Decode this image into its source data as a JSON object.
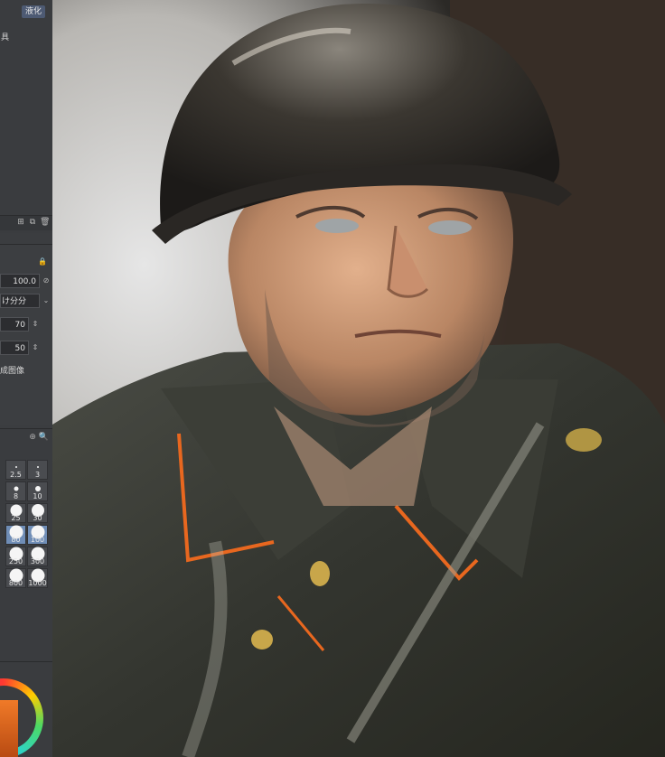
{
  "sidebar": {
    "tab_label": "液化",
    "tool_label": "具",
    "props": {
      "opacity_value": "100.0",
      "mode_value": "け分分",
      "value_a": "70",
      "value_b": "50",
      "option_label": "成图像"
    },
    "brush_sizes": [
      {
        "label": "2.5",
        "dot": 2,
        "selected": false
      },
      {
        "label": "3",
        "dot": 2,
        "selected": false
      },
      {
        "label": "8",
        "dot": 5,
        "selected": false
      },
      {
        "label": "10",
        "dot": 6,
        "selected": false
      },
      {
        "label": "25",
        "dot": 13,
        "selected": false
      },
      {
        "label": "30",
        "dot": 14,
        "selected": false
      },
      {
        "label": "80",
        "dot": 15,
        "selected": true
      },
      {
        "label": "100",
        "dot": 15,
        "selected": true
      },
      {
        "label": "250",
        "dot": 15,
        "selected": false
      },
      {
        "label": "300",
        "dot": 15,
        "selected": false
      },
      {
        "label": "800",
        "dot": 15,
        "selected": false
      },
      {
        "label": "1000",
        "dot": 15,
        "selected": false
      }
    ]
  },
  "colors": {
    "panel_bg": "#3a3c3f",
    "tab_accent": "#4d5a73",
    "selected_cell": "#6f8db6",
    "current_color": "#f07a28"
  }
}
